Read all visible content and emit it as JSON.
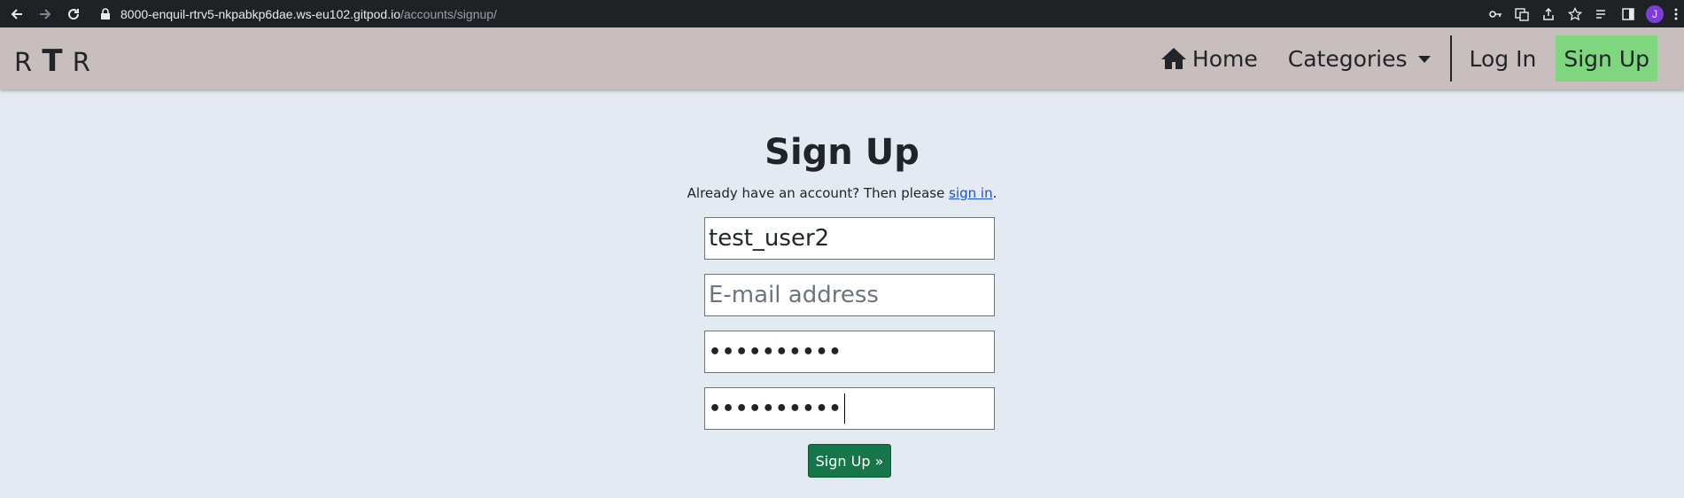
{
  "browser": {
    "url_host": "8000-enquil-rtrv5-nkpabkp6dae.ws-eu102.gitpod.io",
    "url_path": "/accounts/signup/",
    "profile_initial": "J"
  },
  "navbar": {
    "brand_left": "R",
    "brand_mid": "T",
    "brand_right": "R",
    "home_label": "Home",
    "categories_label": "Categories",
    "login_label": "Log In",
    "signup_label": "Sign Up"
  },
  "form": {
    "title": "Sign Up",
    "subtitle_prefix": "Already have an account? Then please ",
    "subtitle_link": "sign in",
    "subtitle_suffix": ".",
    "username_value": "test_user2",
    "email_placeholder": "E-mail address",
    "password_dots": "••••••••••",
    "password2_dots": "••••••••••",
    "submit_label": "Sign Up »"
  }
}
